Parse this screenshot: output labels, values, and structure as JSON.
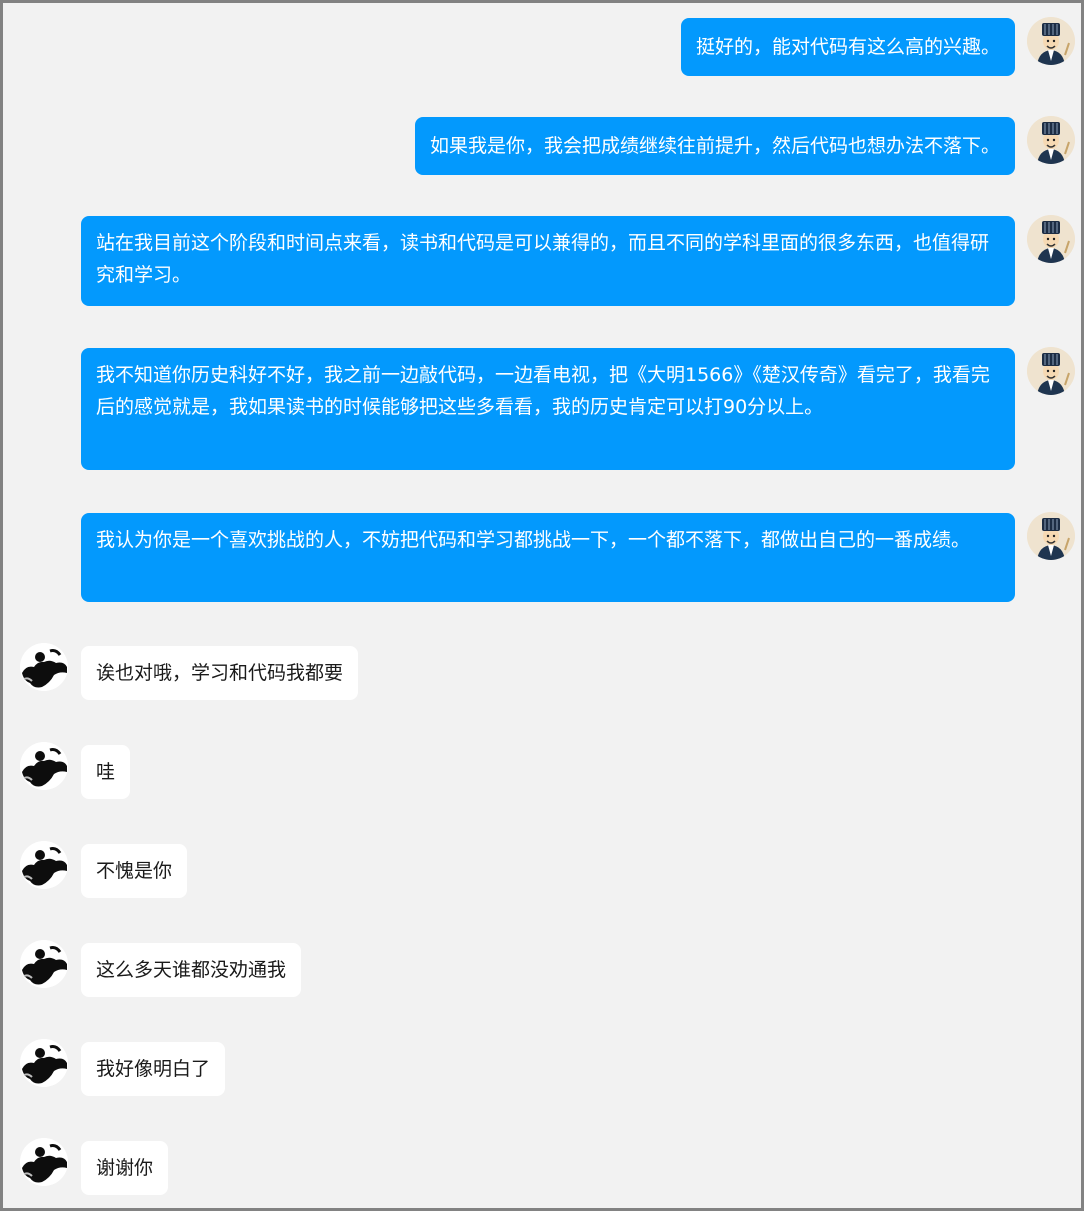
{
  "messages": [
    {
      "side": "right",
      "text": "挺好的，能对代码有这么高的兴趣。"
    },
    {
      "side": "right",
      "text": "如果我是你，我会把成绩继续往前提升，然后代码也想办法不落下。"
    },
    {
      "side": "right",
      "text": "站在我目前这个阶段和时间点来看，读书和代码是可以兼得的，而且不同的学科里面的很多东西，也值得研究和学习。"
    },
    {
      "side": "right",
      "text": "我不知道你历史科好不好，我之前一边敲代码，一边看电视，把《大明1566》《楚汉传奇》看完了，我看完后的感觉就是，我如果读书的时候能够把这些多看看，我的历史肯定可以打90分以上。"
    },
    {
      "side": "right",
      "text": "我认为你是一个喜欢挑战的人，不妨把代码和学习都挑战一下，一个都不落下，都做出自己的一番成绩。"
    },
    {
      "side": "left",
      "text": "诶也对哦，学习和代码我都要"
    },
    {
      "side": "left",
      "text": "哇"
    },
    {
      "side": "left",
      "text": "不愧是你"
    },
    {
      "side": "left",
      "text": "这么多天谁都没劝通我"
    },
    {
      "side": "left",
      "text": "我好像明白了"
    },
    {
      "side": "left",
      "text": "谢谢你"
    }
  ],
  "colors": {
    "background": "#f2f2f2",
    "sent_bubble": "#0399fd",
    "received_bubble": "#ffffff",
    "frame_border": "#828282"
  },
  "icons": {
    "sender_avatar": "advisor-avatar-icon",
    "receiver_avatar": "silhouette-avatar-icon"
  }
}
